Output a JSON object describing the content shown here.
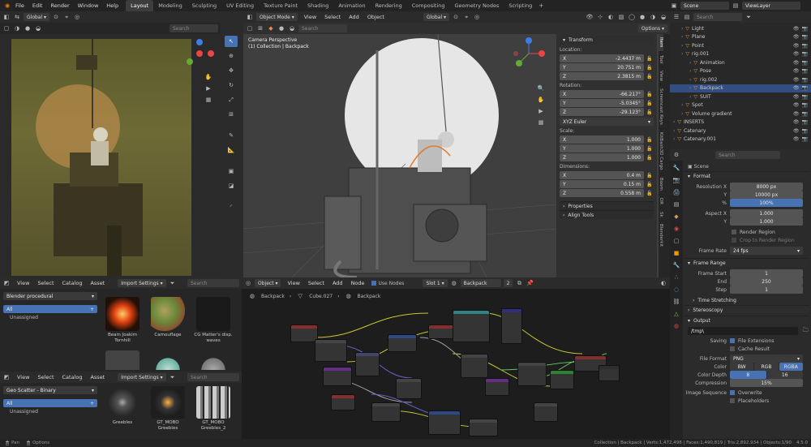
{
  "app": {
    "menus": [
      "File",
      "Edit",
      "Render",
      "Window",
      "Help"
    ],
    "workspaces": [
      "Layout",
      "Modeling",
      "Sculpting",
      "UV Editing",
      "Texture Paint",
      "Shading",
      "Animation",
      "Rendering",
      "Compositing",
      "Geometry Nodes",
      "Scripting"
    ],
    "active_workspace": "Layout",
    "scene": "Scene",
    "view_layer": "ViewLayer"
  },
  "left_view": {
    "orientation": "Global",
    "search_placeholder": "Search"
  },
  "main_view": {
    "mode": "Object Mode",
    "menus": [
      "View",
      "Select",
      "Add",
      "Object"
    ],
    "orientation": "Global",
    "options": "Options",
    "overlay_title": "Camera Perspective",
    "overlay_sub": "(1) Collection | Backpack",
    "search_placeholder": "Search"
  },
  "transform": {
    "title": "Transform",
    "location_label": "Location:",
    "location": [
      {
        "axis": "X",
        "v": "-2.4437 m"
      },
      {
        "axis": "Y",
        "v": "20.751 m"
      },
      {
        "axis": "Z",
        "v": "2.3815 m"
      }
    ],
    "rotation_label": "Rotation:",
    "rotation": [
      {
        "axis": "X",
        "v": "-66.217°"
      },
      {
        "axis": "Y",
        "v": "-5.0345°"
      },
      {
        "axis": "Z",
        "v": "-29.123°"
      }
    ],
    "rot_mode": "XYZ Euler",
    "scale_label": "Scale:",
    "scale": [
      {
        "axis": "X",
        "v": "1.000"
      },
      {
        "axis": "Y",
        "v": "1.000"
      },
      {
        "axis": "Z",
        "v": "1.000"
      }
    ],
    "dim_label": "Dimensions:",
    "dims": [
      {
        "axis": "X",
        "v": "0.4 m"
      },
      {
        "axis": "Y",
        "v": "0.15 m"
      },
      {
        "axis": "Z",
        "v": "0.558 m"
      }
    ],
    "properties": "Properties",
    "align": "Align Tools"
  },
  "side_tabs": [
    "Item",
    "Tool",
    "View",
    "Screencast Keys",
    "KitBash3D Cargo",
    "Boom",
    "DR",
    "Sk",
    "Blenderkit"
  ],
  "outliner": {
    "search_placeholder": "Search",
    "items": [
      {
        "name": "Light",
        "indent": 1
      },
      {
        "name": "Plane",
        "indent": 1
      },
      {
        "name": "Point",
        "indent": 1
      },
      {
        "name": "rig.001",
        "indent": 1
      },
      {
        "name": "Animation",
        "indent": 2
      },
      {
        "name": "Pose",
        "indent": 2
      },
      {
        "name": "rig.002",
        "indent": 2
      },
      {
        "name": "Backpack",
        "indent": 2,
        "selected": true
      },
      {
        "name": "SUIT",
        "indent": 2
      },
      {
        "name": "Spot",
        "indent": 1
      },
      {
        "name": "Volume gradient",
        "indent": 1
      },
      {
        "name": "INSERTS",
        "indent": 0
      },
      {
        "name": "Catenary",
        "indent": 0
      },
      {
        "name": "Catenary.001",
        "indent": 0
      }
    ]
  },
  "props": {
    "search_placeholder": "Search",
    "scene": "Scene",
    "format": "Format",
    "res_x_label": "Resolution X",
    "res_x": "8000 px",
    "res_y_label": "Y",
    "res_y": "10000 px",
    "pct_label": "%",
    "pct": "100%",
    "aspect_x_label": "Aspect X",
    "aspect_x": "1.000",
    "aspect_y_label": "Y",
    "aspect_y": "1.000",
    "render_region": "Render Region",
    "crop": "Crop to Render Region",
    "fps_label": "Frame Rate",
    "fps": "24 fps",
    "frame_range": "Frame Range",
    "fstart_label": "Frame Start",
    "fstart": "1",
    "fend_label": "End",
    "fend": "250",
    "fstep_label": "Step",
    "fstep": "1",
    "time_stretch": "Time Stretching",
    "stereo": "Stereoscopy",
    "output": "Output",
    "path": "/tmp\\",
    "saving_label": "Saving",
    "file_ext": "File Extensions",
    "cache": "Cache Result",
    "ff_label": "File Format",
    "ff": "PNG",
    "color_label": "Color",
    "color_opts": [
      "BW",
      "RGB",
      "RGBA"
    ],
    "depth_label": "Color Depth",
    "depth_opts": [
      "8",
      "16"
    ],
    "comp_label": "Compression",
    "comp": "15%",
    "seq_label": "Image Sequence",
    "overwrite": "Overwrite",
    "placeholders": "Placeholders"
  },
  "asset1": {
    "menus": [
      "View",
      "Select",
      "Catalog",
      "Asset"
    ],
    "import": "Import Settings",
    "search_placeholder": "Search",
    "library": "Blender procedural",
    "cat_all": "All",
    "cat_unassigned": "Unassigned",
    "items": [
      "Beam Joakim Tornhill",
      "Camouflage",
      "CG Matter's disp. waves"
    ]
  },
  "asset2": {
    "menus": [
      "View",
      "Select",
      "Catalog",
      "Asset"
    ],
    "import": "Import Settings",
    "search_placeholder": "Search",
    "library": "Geo Scatter - Binary",
    "cat_all": "All",
    "cat_unassigned": "Unassigned",
    "items": [
      "Greebles",
      "GT_MOBO Greebles",
      "GT_MOBO Greebles_2"
    ]
  },
  "node_editor": {
    "type": "Object",
    "menus": [
      "View",
      "Select",
      "Add",
      "Node"
    ],
    "use_nodes": "Use Nodes",
    "slot": "Slot 1",
    "material": "Backpack",
    "users": "2",
    "crumbs": [
      "Backpack",
      "Cube.027",
      "Backpack"
    ]
  },
  "status": {
    "pan": "Pan",
    "options": "Options",
    "stats": "Collection | Backpack | Verts:1,472,498 | Faces:1,490,819 | Tris:2,892,934 | Objects:1/90",
    "version": "4.5.0"
  },
  "colors": {
    "accent": "#4772b3",
    "selected_row": "#334d80",
    "moon": "#e6e6e6"
  }
}
